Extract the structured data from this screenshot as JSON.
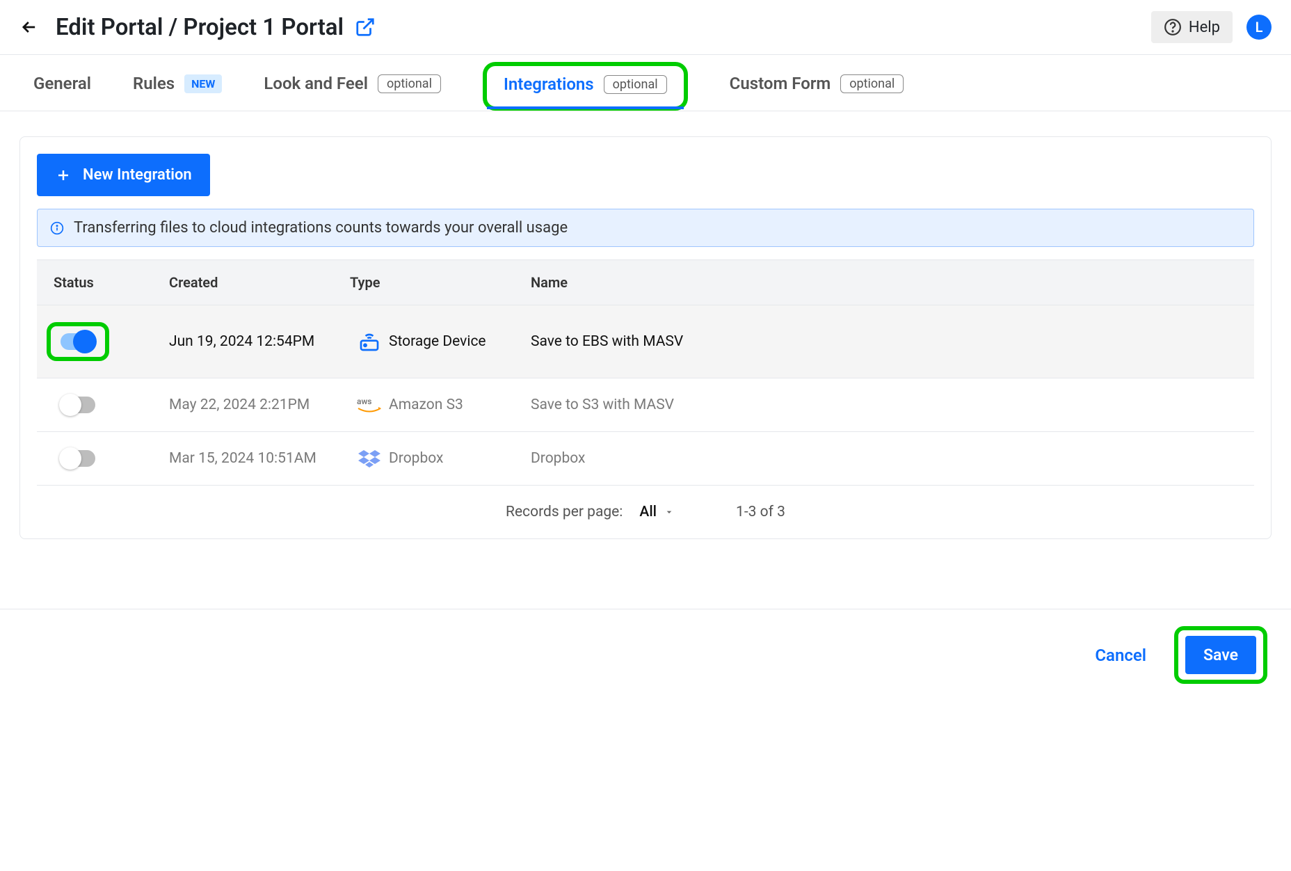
{
  "header": {
    "title": "Edit Portal / Project 1 Portal",
    "help_label": "Help",
    "avatar_letter": "L"
  },
  "tabs": [
    {
      "label": "General",
      "badge": null
    },
    {
      "label": "Rules",
      "badge": "NEW"
    },
    {
      "label": "Look and Feel",
      "badge": "optional"
    },
    {
      "label": "Integrations",
      "badge": "optional"
    },
    {
      "label": "Custom Form",
      "badge": "optional"
    }
  ],
  "integrations": {
    "new_button": "New Integration",
    "info_text": "Transferring files to cloud integrations counts towards your overall usage",
    "columns": {
      "status": "Status",
      "created": "Created",
      "type": "Type",
      "name": "Name"
    },
    "rows": [
      {
        "enabled": true,
        "created": "Jun 19, 2024 12:54PM",
        "type": "Storage Device",
        "name": "Save to EBS with MASV",
        "icon": "storage"
      },
      {
        "enabled": false,
        "created": "May 22, 2024 2:21PM",
        "type": "Amazon S3",
        "name": "Save to S3 with MASV",
        "icon": "aws"
      },
      {
        "enabled": false,
        "created": "Mar 15, 2024 10:51AM",
        "type": "Dropbox",
        "name": "Dropbox",
        "icon": "dropbox"
      }
    ],
    "pager": {
      "label": "Records per page:",
      "value": "All",
      "range": "1-3 of 3"
    }
  },
  "footer": {
    "cancel": "Cancel",
    "save": "Save"
  }
}
